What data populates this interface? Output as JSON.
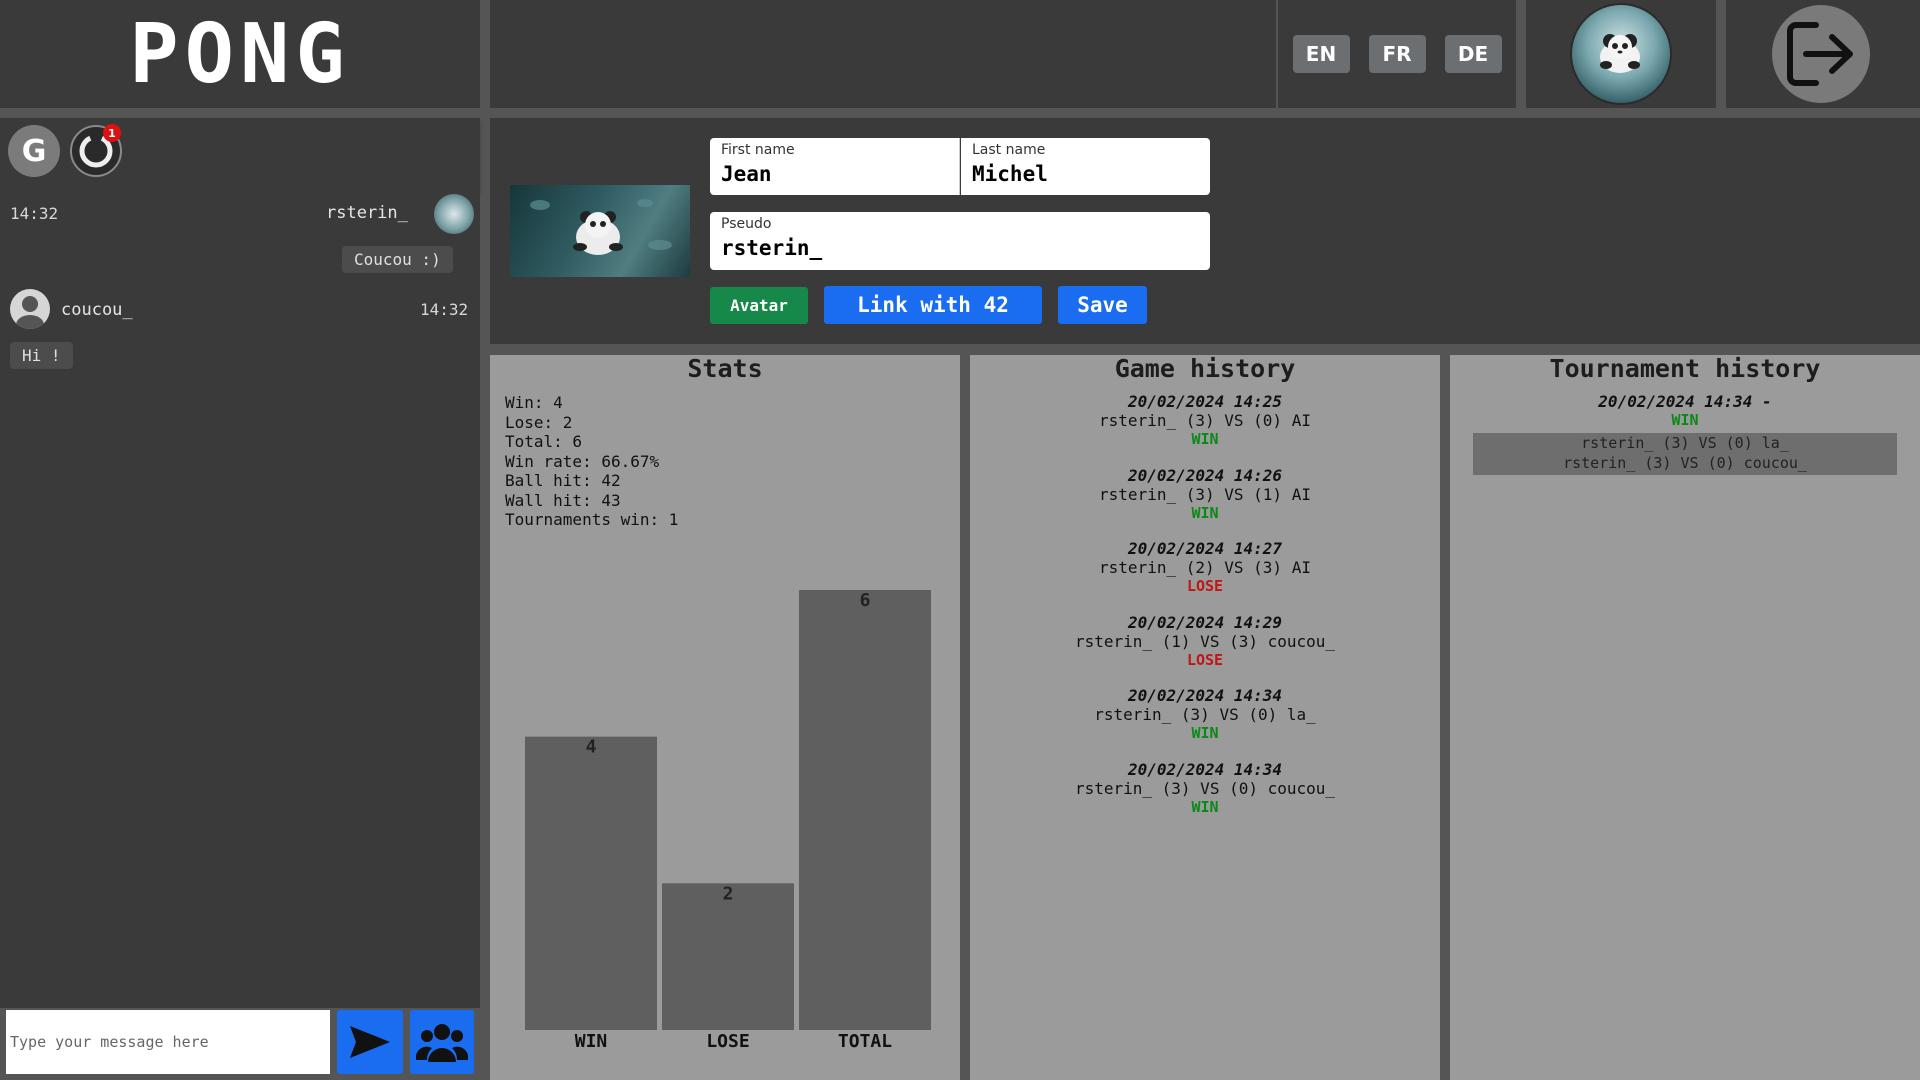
{
  "header": {
    "logo": "PONG",
    "languages": [
      "EN",
      "FR",
      "DE"
    ]
  },
  "chat": {
    "tabs": [
      {
        "label": "G",
        "icon": "globe-g-icon"
      },
      {
        "label": "",
        "icon": "chat-avatar-icon",
        "badge": "1"
      }
    ],
    "messages": [
      {
        "time": "14:32",
        "user": "rsterin_",
        "text": "Coucou :)"
      },
      {
        "time": "14:32",
        "user": "coucou_",
        "text": "Hi !"
      }
    ],
    "input_placeholder": "Type your message here"
  },
  "profile": {
    "first_name_label": "First name",
    "first_name": "Jean",
    "last_name_label": "Last name",
    "last_name": "Michel",
    "pseudo_label": "Pseudo",
    "pseudo": "rsterin_",
    "avatar_button": "Avatar",
    "link_button": "Link with 42",
    "save_button": "Save"
  },
  "stats": {
    "title": "Stats",
    "lines": [
      "Win: 4",
      "Lose: 2",
      "Total: 6",
      "Win rate: 66.67%",
      "Ball hit: 42",
      "Wall hit: 43",
      "Tournaments win: 1"
    ]
  },
  "chart_data": {
    "type": "bar",
    "categories": [
      "WIN",
      "LOSE",
      "TOTAL"
    ],
    "values": [
      4,
      2,
      6
    ],
    "title": "",
    "xlabel": "",
    "ylabel": "",
    "ylim": [
      0,
      6
    ]
  },
  "game_history": {
    "title": "Game history",
    "entries": [
      {
        "date": "20/02/2024 14:25",
        "match": "rsterin_ (3) VS (0) AI",
        "result": "WIN"
      },
      {
        "date": "20/02/2024 14:26",
        "match": "rsterin_ (3) VS (1) AI",
        "result": "WIN"
      },
      {
        "date": "20/02/2024 14:27",
        "match": "rsterin_ (2) VS (3) AI",
        "result": "LOSE"
      },
      {
        "date": "20/02/2024 14:29",
        "match": "rsterin_ (1) VS (3) coucou_",
        "result": "LOSE"
      },
      {
        "date": "20/02/2024 14:34",
        "match": "rsterin_ (3) VS (0) la_",
        "result": "WIN"
      },
      {
        "date": "20/02/2024 14:34",
        "match": "rsterin_ (3) VS (0) coucou_",
        "result": "WIN"
      }
    ]
  },
  "tournament_history": {
    "title": "Tournament history",
    "entries": [
      {
        "date": "20/02/2024 14:34 -",
        "result": "WIN",
        "matches": [
          "rsterin_ (3) VS (0) la_",
          "rsterin_ (3) VS (0) coucou_"
        ]
      }
    ]
  },
  "colors": {
    "accent": "#1a6cf0",
    "avatar_button": "#16884a",
    "win": "#0a8a15",
    "lose": "#c01616"
  }
}
